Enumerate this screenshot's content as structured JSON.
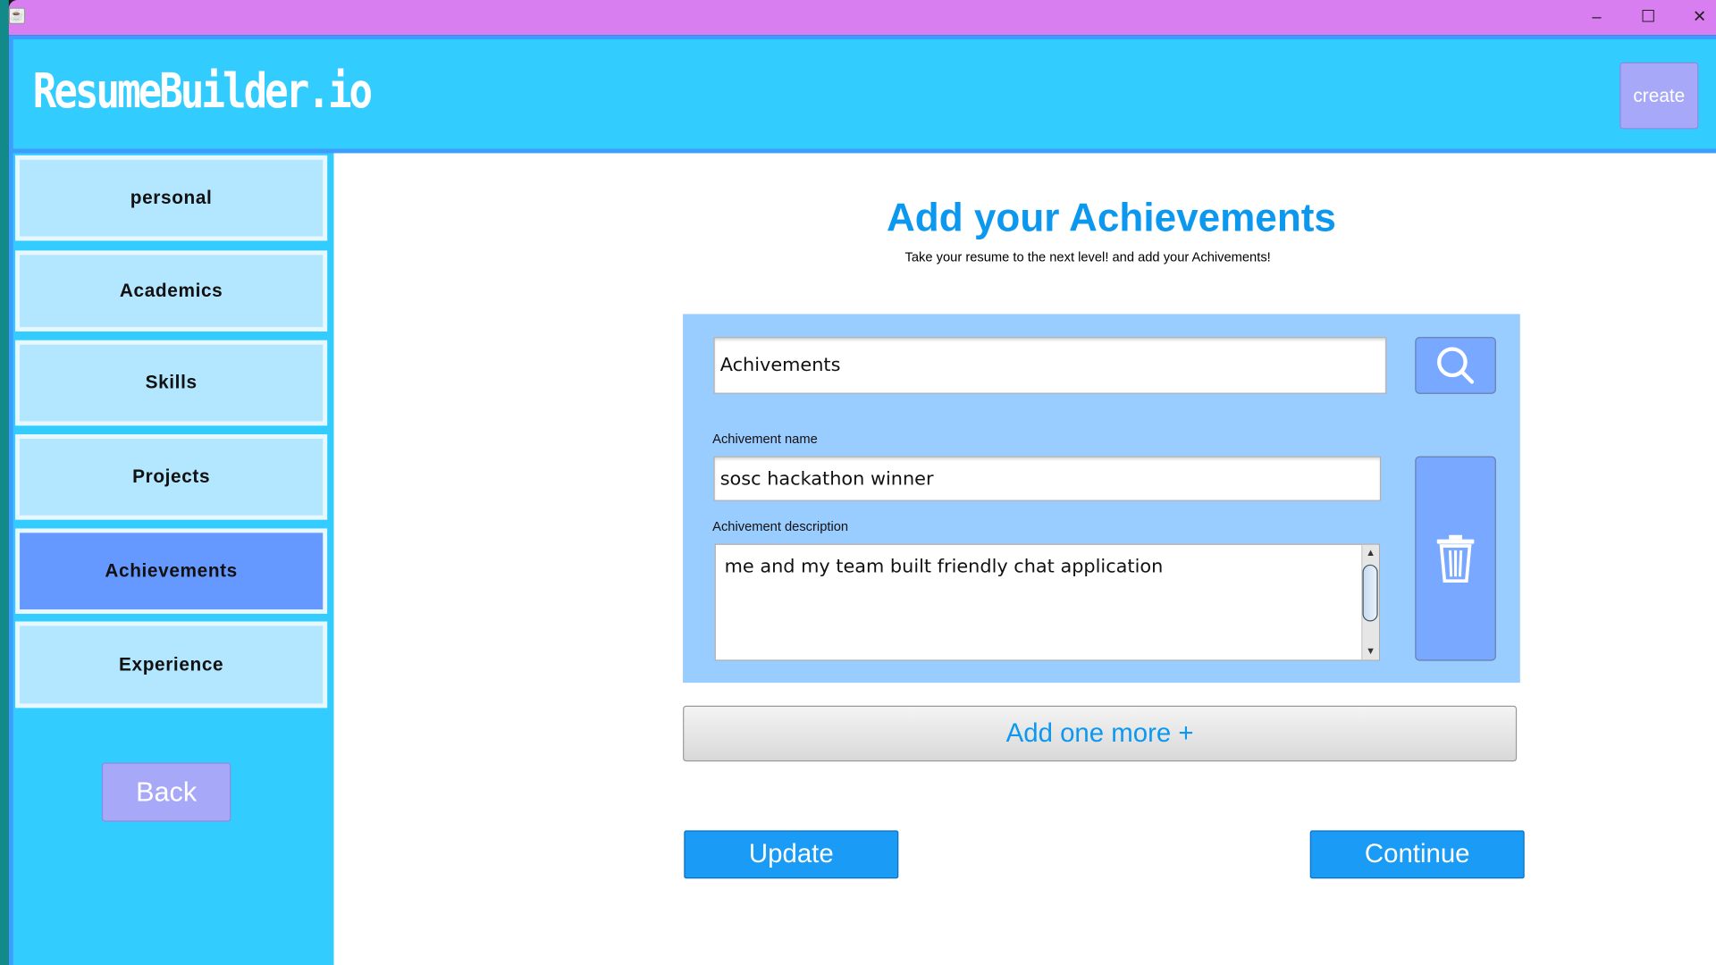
{
  "window": {
    "controls": {
      "minimize": "–",
      "maximize": "☐",
      "close": "✕"
    }
  },
  "header": {
    "logo": "ResumeBuilder.io",
    "create_label": "create"
  },
  "sidebar": {
    "items": [
      {
        "label": "personal",
        "active": false
      },
      {
        "label": "Academics",
        "active": false
      },
      {
        "label": "Skills",
        "active": false
      },
      {
        "label": "Projects",
        "active": false
      },
      {
        "label": "Achievements",
        "active": true
      },
      {
        "label": "Experience",
        "active": false
      }
    ],
    "back_label": "Back"
  },
  "main": {
    "title": "Add your Achievements",
    "subtitle": "Take your resume to the next level! and add your Achivements!",
    "search_value": "Achivements",
    "name_label": "Achivement name",
    "name_value": "sosc hackathon winner",
    "desc_label": "Achivement description",
    "desc_value": "me and my team built friendly chat application",
    "add_more_label": "Add one more +",
    "update_label": "Update",
    "continue_label": "Continue"
  },
  "colors": {
    "titlebar": "#d97ef0",
    "header": "#33ccff",
    "accent": "#0d98ef",
    "active_nav": "#6699ff",
    "panel": "#99ccff"
  },
  "icons": {
    "search": "search-icon",
    "delete": "trash-icon"
  }
}
